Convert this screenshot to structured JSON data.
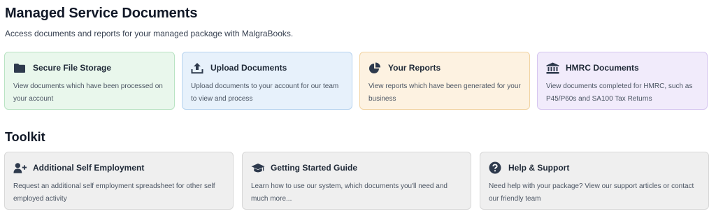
{
  "header": {
    "title": "Managed Service Documents",
    "subtitle": "Access documents and reports for your managed package with MalgraBooks."
  },
  "documents": [
    {
      "icon": "folder-icon",
      "title": "Secure File Storage",
      "description": "View documents which have been processed on your account",
      "color": "#e9f7ec"
    },
    {
      "icon": "upload-icon",
      "title": "Upload Documents",
      "description": "Upload documents to your account for our team to view and process",
      "color": "#e7f1fb"
    },
    {
      "icon": "pie-chart-icon",
      "title": "Your Reports",
      "description": "View reports which have been generated for your business",
      "color": "#fdf2e1"
    },
    {
      "icon": "bank-icon",
      "title": "HMRC Documents",
      "description": "View documents completed for HMRC, such as P45/P60s and SA100 Tax Returns",
      "color": "#f1ebfb"
    }
  ],
  "toolkit": {
    "title": "Toolkit",
    "items": [
      {
        "icon": "add-user-icon",
        "title": "Additional Self Employment",
        "description": "Request an additional self employment spreadsheet for other self employed activity"
      },
      {
        "icon": "graduation-cap-icon",
        "title": "Getting Started Guide",
        "description": "Learn how to use our system, which documents you'll need and much more..."
      },
      {
        "icon": "question-circle-icon",
        "title": "Help & Support",
        "description": "Need help with your package? View our support articles or contact our friendly team"
      }
    ]
  }
}
